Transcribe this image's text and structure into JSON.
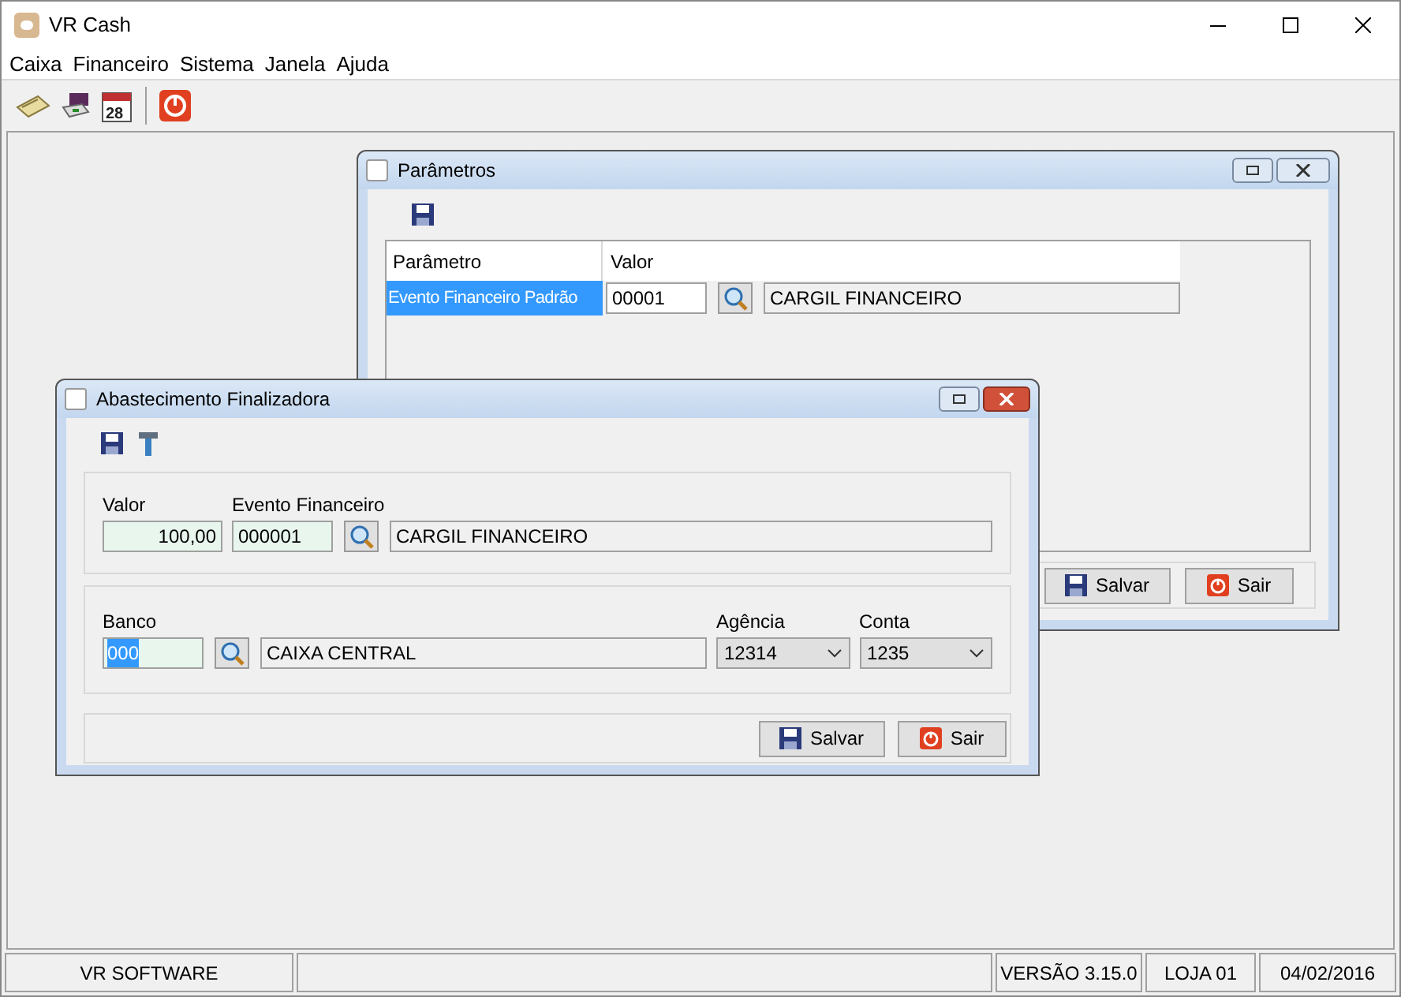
{
  "window": {
    "title": "VR Cash"
  },
  "menu": [
    "Caixa",
    "Financeiro",
    "Sistema",
    "Janela",
    "Ajuda"
  ],
  "parametros": {
    "title": "Parâmetros",
    "columns": [
      "Parâmetro",
      "Valor"
    ],
    "rows": [
      {
        "parameter": "Evento Financeiro Padrão",
        "selected": true,
        "code": "00001",
        "description": "CARGIL FINANCEIRO"
      }
    ],
    "buttons": [
      {
        "label": "Salvar",
        "kind": "save"
      },
      {
        "label": "Sair",
        "kind": "exit"
      }
    ]
  },
  "abastecimento": {
    "title": "Abastecimento Finalizadora",
    "valor_label": "Valor",
    "valor": "100,00",
    "evento_label": "Evento Financeiro",
    "evento_code": "000001",
    "evento_description": "CARGIL FINANCEIRO",
    "banco_label": "Banco",
    "banco_code": "000",
    "banco_code_highlighted": true,
    "banco_name": "CAIXA CENTRAL",
    "agencia_label": "Agência",
    "agencia": "12314",
    "conta_label": "Conta",
    "conta": "1235",
    "buttons": [
      {
        "label": "Salvar",
        "kind": "save"
      },
      {
        "label": "Sair",
        "kind": "exit"
      }
    ]
  },
  "toolbar": {
    "calendar_day": "28"
  },
  "status_bar": {
    "left": "VR SOFTWARE",
    "right": [
      "VERSÃO 3.15.0",
      "LOJA 01",
      "04/02/2016"
    ]
  }
}
